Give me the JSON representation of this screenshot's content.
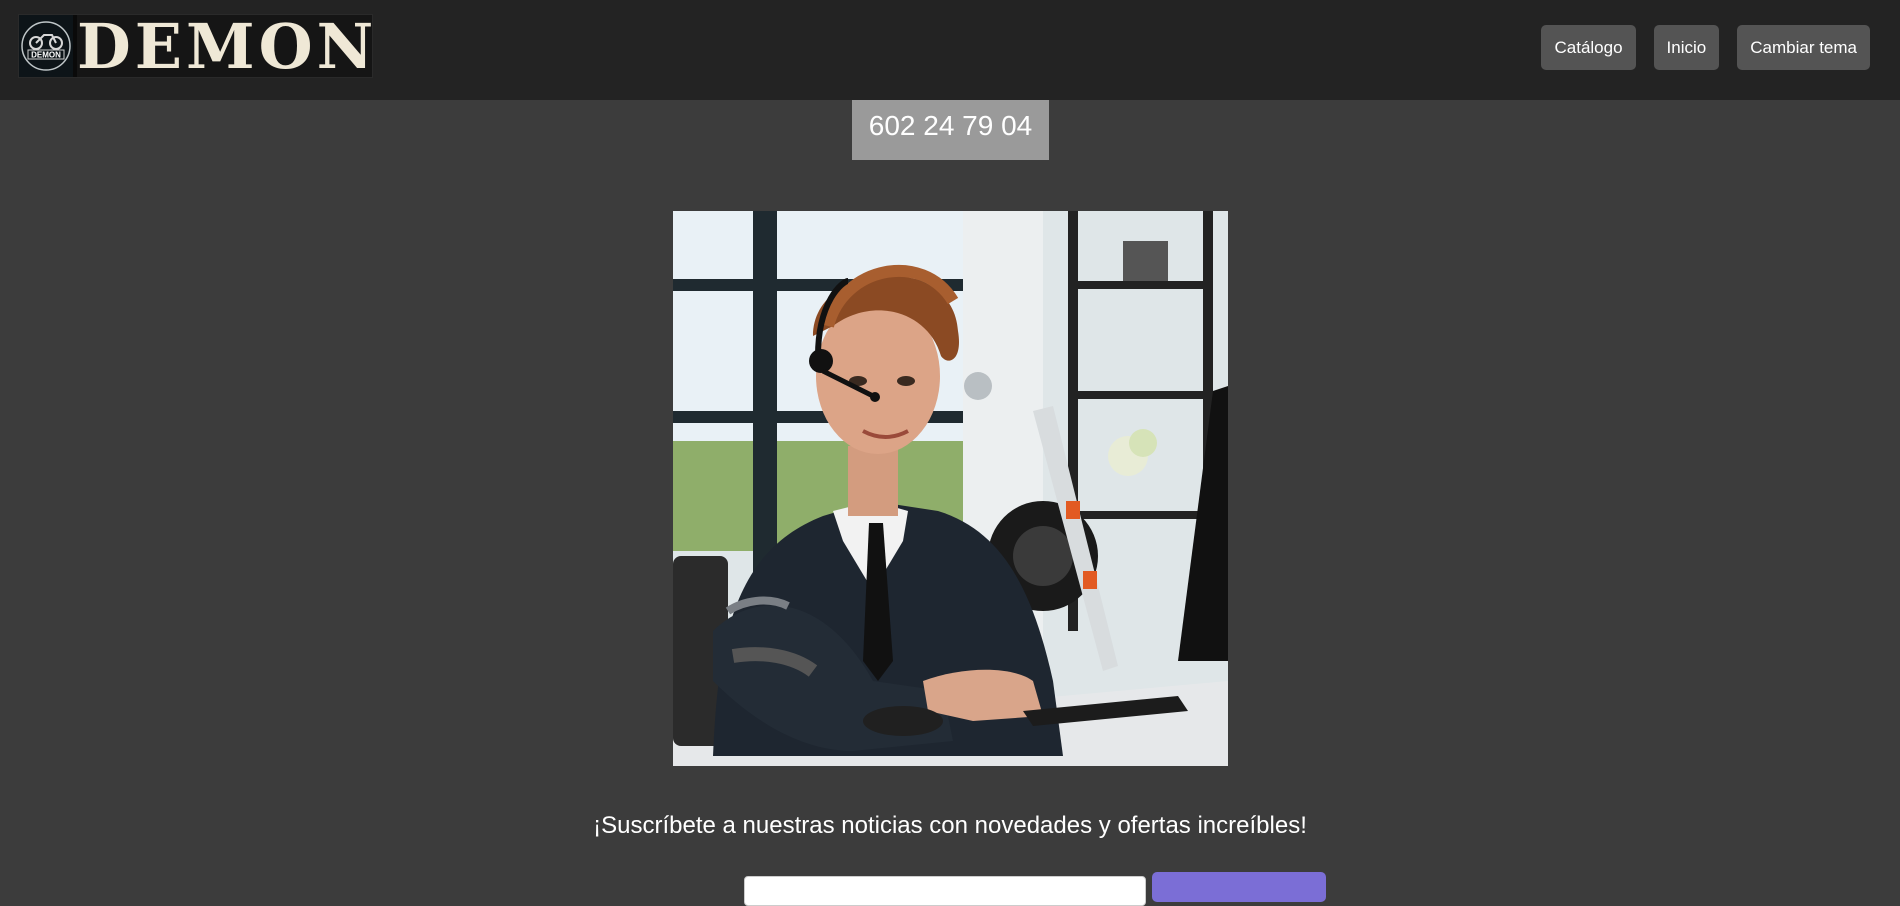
{
  "header": {
    "logo_text": "DEMON",
    "logo_emblem_text": "DEMON"
  },
  "nav": {
    "items": [
      {
        "label": "Catálogo"
      },
      {
        "label": "Inicio"
      },
      {
        "label": "Cambiar tema"
      }
    ]
  },
  "contact": {
    "phone": "602 24 79 04"
  },
  "newsletter": {
    "text": "¡Suscríbete a nuestras noticias con novedades y ofertas increíbles!",
    "email_value": "",
    "button_label": ""
  },
  "colors": {
    "header_bg": "#232323",
    "page_bg": "#3c3c3c",
    "nav_button_bg": "#545454",
    "phone_bg": "#9a9a9a",
    "subscribe_button_bg": "#7b6ed6"
  }
}
